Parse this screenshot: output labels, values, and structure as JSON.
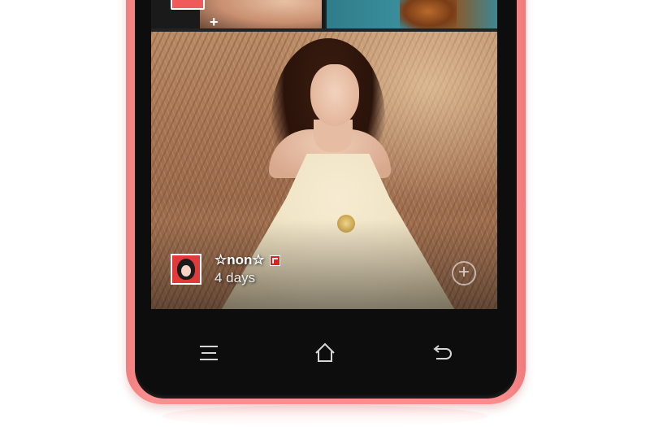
{
  "feed": {
    "post": {
      "username": "☆non☆",
      "time_ago": "4 days",
      "source_badge": "flipboard-icon",
      "add_icon": "plus-circle-icon"
    },
    "top_strip": {
      "plus": "+"
    }
  },
  "nav_bar": {
    "menu": "menu-icon",
    "home": "home-icon",
    "back": "back-icon"
  },
  "colors": {
    "shell": "#fb8c8c",
    "bezel": "#0d0d0e",
    "badge": "#e0201d"
  }
}
